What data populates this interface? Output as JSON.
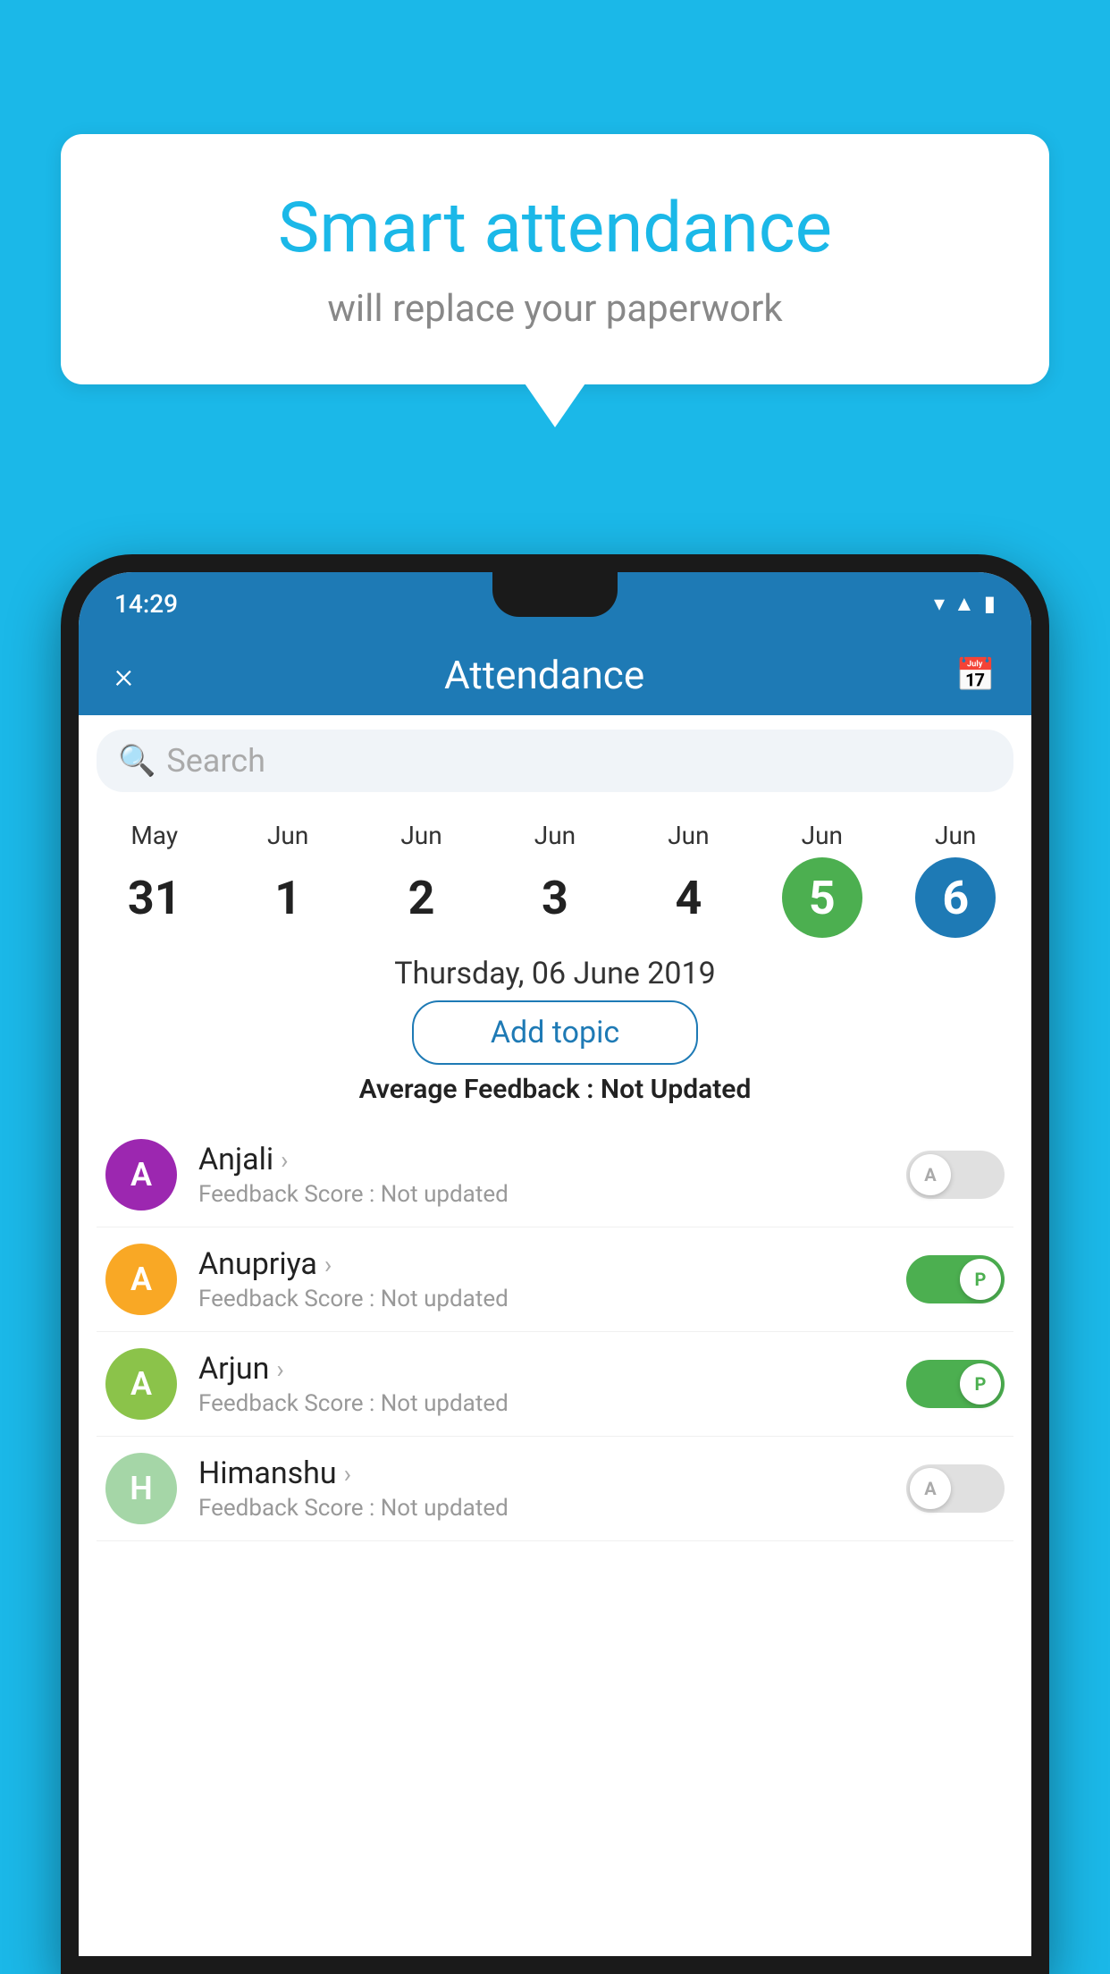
{
  "background_color": "#1bb8e8",
  "bubble": {
    "title": "Smart attendance",
    "subtitle": "will replace your paperwork"
  },
  "status_bar": {
    "time": "14:29",
    "icons": [
      "wifi",
      "signal",
      "battery"
    ]
  },
  "header": {
    "title": "Attendance",
    "close_label": "×",
    "calendar_icon": "📅"
  },
  "search": {
    "placeholder": "Search"
  },
  "dates": [
    {
      "month": "May",
      "day": "31",
      "style": "normal"
    },
    {
      "month": "Jun",
      "day": "1",
      "style": "normal"
    },
    {
      "month": "Jun",
      "day": "2",
      "style": "normal"
    },
    {
      "month": "Jun",
      "day": "3",
      "style": "normal"
    },
    {
      "month": "Jun",
      "day": "4",
      "style": "normal"
    },
    {
      "month": "Jun",
      "day": "5",
      "style": "today"
    },
    {
      "month": "Jun",
      "day": "6",
      "style": "selected"
    }
  ],
  "selected_date_label": "Thursday, 06 June 2019",
  "add_topic_label": "Add topic",
  "avg_feedback_label": "Average Feedback : ",
  "avg_feedback_value": "Not Updated",
  "students": [
    {
      "name": "Anjali",
      "avatar_letter": "A",
      "avatar_color": "#9c27b0",
      "feedback": "Feedback Score : Not updated",
      "attendance": "absent"
    },
    {
      "name": "Anupriya",
      "avatar_letter": "A",
      "avatar_color": "#f9a825",
      "feedback": "Feedback Score : Not updated",
      "attendance": "present"
    },
    {
      "name": "Arjun",
      "avatar_letter": "A",
      "avatar_color": "#8bc34a",
      "feedback": "Feedback Score : Not updated",
      "attendance": "present"
    },
    {
      "name": "Himanshu",
      "avatar_letter": "H",
      "avatar_color": "#a5d6a7",
      "feedback": "Feedback Score : Not updated",
      "attendance": "absent"
    }
  ],
  "toggle_absent_label": "A",
  "toggle_present_label": "P"
}
